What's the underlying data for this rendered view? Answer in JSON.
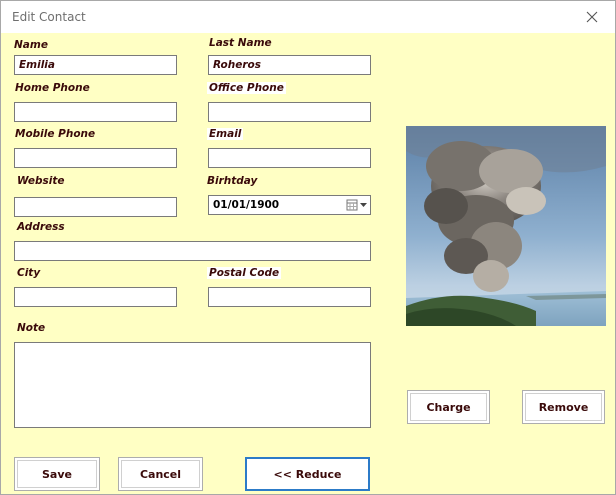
{
  "window": {
    "title": "Edit Contact"
  },
  "form": {
    "name": {
      "label": "Name",
      "value": "Emilia"
    },
    "last_name": {
      "label": "Last Name",
      "value": "Roheros"
    },
    "home_phone": {
      "label": "Home Phone",
      "value": ""
    },
    "office_phone": {
      "label": "Office Phone",
      "value": ""
    },
    "mobile_phone": {
      "label": "Mobile Phone",
      "value": ""
    },
    "email": {
      "label": "Email",
      "value": ""
    },
    "website": {
      "label": "Website",
      "value": ""
    },
    "birthday": {
      "label": "Birhtday",
      "value": "01/01/1900"
    },
    "address": {
      "label": "Address",
      "value": ""
    },
    "city": {
      "label": "City",
      "value": ""
    },
    "postal_code": {
      "label": "Postal Code",
      "value": ""
    },
    "note": {
      "label": "Note",
      "value": ""
    }
  },
  "photo": {
    "icon": "volcano-eruption-photo"
  },
  "buttons": {
    "charge": "Charge",
    "remove": "Remove",
    "save": "Save",
    "cancel": "Cancel",
    "reduce": "<< Reduce"
  },
  "colors": {
    "background": "#ffffc4",
    "label_text": "#3a0a0a",
    "default_button_border": "#2c7bc8"
  }
}
